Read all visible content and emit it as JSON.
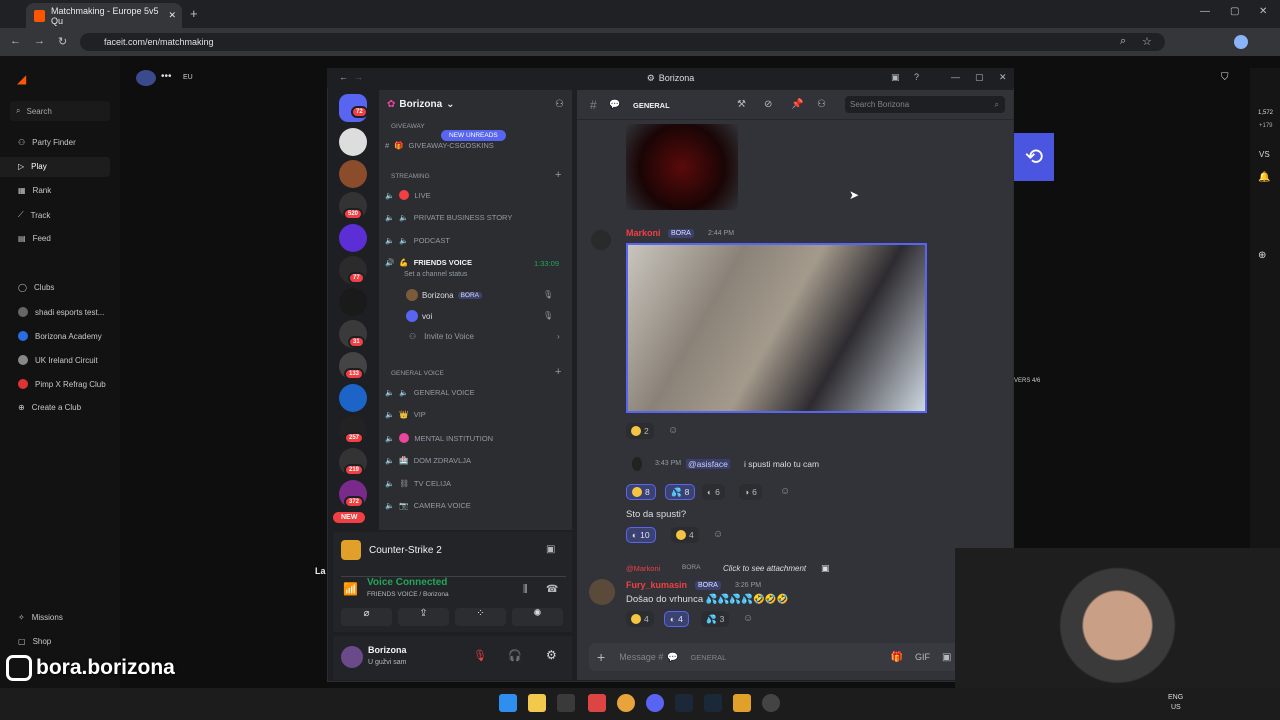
{
  "browser": {
    "tab_title": "Matchmaking - Europe 5v5 Qu",
    "url": "faceit.com/en/matchmaking"
  },
  "faceit": {
    "search": "Search",
    "nav": [
      {
        "label": "Party Finder"
      },
      {
        "label": "Play"
      },
      {
        "label": "Rank"
      },
      {
        "label": "Track"
      },
      {
        "label": "Feed"
      }
    ],
    "clubs": [
      {
        "label": "Clubs"
      },
      {
        "label": "shadi esports test..."
      },
      {
        "label": "Borizona Academy"
      },
      {
        "label": "UK Ireland Circuit"
      },
      {
        "label": "Pimp X Refrag Club"
      },
      {
        "label": "Create a Club"
      }
    ],
    "bottom": [
      {
        "label": "Missions"
      },
      {
        "label": "Shop"
      }
    ],
    "region": "EU",
    "players": "VERS 4/6",
    "la": "La",
    "right_badges": [
      "1,572",
      "+179",
      "VS"
    ]
  },
  "discord": {
    "window_title": "Borizona",
    "server_name": "Borizona",
    "new_unreads": "NEW UNREADS",
    "channel_name": "GENERAL",
    "search_placeholder": "Search Borizona",
    "guild_badges": [
      "72",
      "520",
      "77",
      "31",
      "133",
      "257",
      "219",
      "372"
    ],
    "new_label": "NEW",
    "channels": {
      "giveaway_cat": "GIVEAWAY",
      "giveaway_ch": "GIVEAWAY-CSGOSKINS",
      "streaming_cat": "STREAMING",
      "live": "LIVE",
      "pbs": "PRIVATE BUSINESS STORY",
      "podcast": "PODCAST",
      "friends": "FRIENDS VOICE",
      "friends_timer": "1:33:09",
      "set_status": "Set a channel status",
      "user1": "Borizona",
      "user1_tag": "BORA",
      "user2": "voi",
      "invite": "Invite to Voice",
      "general_cat": "GENERAL VOICE",
      "general_voice": "GENERAL VOICE",
      "vip": "VIP",
      "mental": "MENTAL INSTITUTION",
      "dom": "DOM ZDRAVLJA",
      "tv": "TV CELIJA",
      "camera": "CAMERA VOICE"
    },
    "activity": "Counter-Strike 2",
    "voice_status": "Voice Connected",
    "voice_channel": "FRIENDS VOICE / Borizona",
    "me_name": "Borizona",
    "me_status": "U gužvi sam",
    "messages": {
      "m1_author": "Markoni",
      "m1_tag": "BORA",
      "m1_time": "2:44 PM",
      "r1": "2",
      "reply_time": "3:43 PM",
      "reply_mention": "@asisface",
      "reply_text": "i spusti malo tu cam",
      "r2": [
        "8",
        "8",
        "6",
        "6"
      ],
      "m2_text": "Sto da spusti?",
      "r3": [
        "10",
        "4"
      ],
      "reply2_author": "@Markoni",
      "reply2_tag": "BORA",
      "reply2_text": "Click to see attachment",
      "m3_author": "Fury_kumasin",
      "m3_tag": "BORA",
      "m3_time": "3:26 PM",
      "m3_text": "Došao do vrhunca 💦💦💦💦🤣🤣🤣",
      "r4": [
        "4",
        "4",
        "3"
      ]
    },
    "composer_placeholder": "Message #",
    "composer_channel": "GENERAL"
  },
  "instagram": "bora.borizona",
  "tray": {
    "lang1": "ENG",
    "lang2": "US"
  },
  "colors": {
    "accent": "#5865f2",
    "danger": "#f23f43",
    "faceit": "#ff5500",
    "green": "#23a55a"
  }
}
